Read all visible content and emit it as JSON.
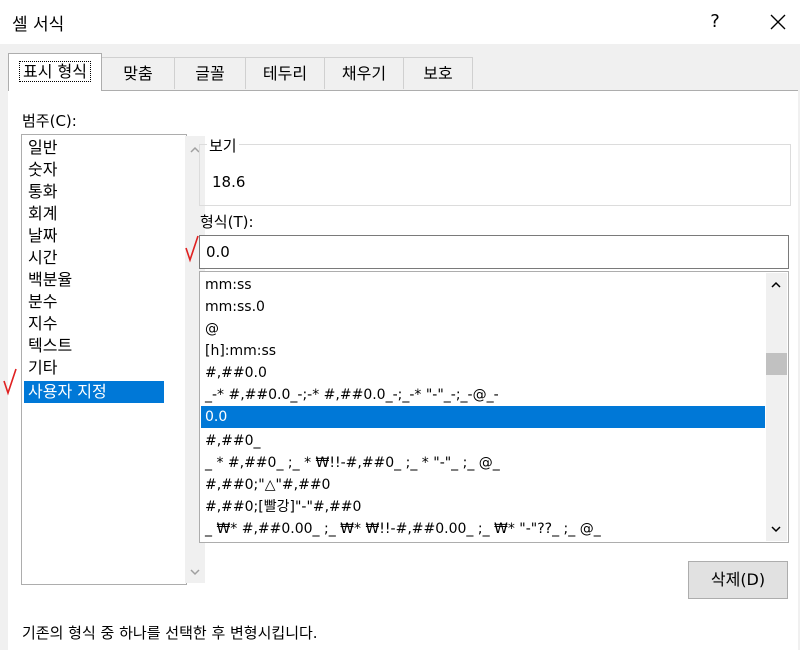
{
  "window": {
    "title": "셀 서식",
    "help_glyph": "?",
    "close_icon": "close-icon"
  },
  "tabs": [
    {
      "label": "표시 형식",
      "active": true
    },
    {
      "label": "맞춤"
    },
    {
      "label": "글꼴"
    },
    {
      "label": "테두리"
    },
    {
      "label": "채우기"
    },
    {
      "label": "보호"
    }
  ],
  "category": {
    "label": "범주(C):",
    "items": [
      "일반",
      "숫자",
      "통화",
      "회계",
      "날짜",
      "시간",
      "백분율",
      "분수",
      "지수",
      "텍스트",
      "기타",
      "사용자 지정"
    ],
    "selected_index": 11
  },
  "preview": {
    "label": "보기",
    "value": "18.6"
  },
  "format": {
    "label": "형식(T):",
    "value": "0.0",
    "items": [
      "mm:ss",
      "mm:ss.0",
      "@",
      "[h]:mm:ss",
      "#,##0.0",
      "_-* #,##0.0_-;-* #,##0.0_-;_-* \"-\"_-;_-@_-",
      "0.0",
      "#,##0_",
      "_ * #,##0_ ;_ * ₩!!-#,##0_ ;_ * \"-\"_ ;_ @_",
      "#,##0;\"△\"#,##0",
      "#,##0;[빨강]\"-\"#,##0",
      "_ ₩* #,##0.00_ ;_ ₩* ₩!!-#,##0.00_ ;_ ₩* \"-\"??_ ;_ @_"
    ],
    "selected_index": 6
  },
  "buttons": {
    "delete": "삭제(D)"
  },
  "description": "기존의 형식 중 하나를 선택한 후 변형시킵니다.",
  "colors": {
    "selection": "#0078d7",
    "annotation": "#e02020"
  }
}
